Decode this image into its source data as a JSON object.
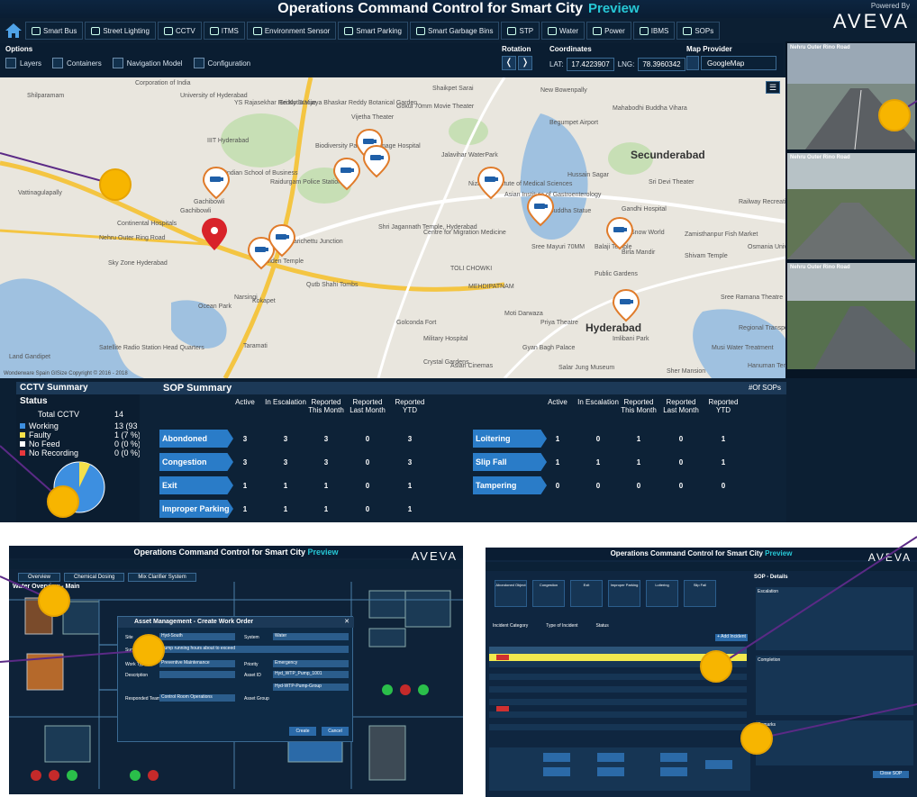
{
  "app": {
    "title": "Operations Command Control for Smart City",
    "preview": "Preview",
    "powered_by": "Powered By",
    "brand": "AVEVA"
  },
  "nav": {
    "items": [
      {
        "label": "Smart Bus",
        "icon": "bus-icon"
      },
      {
        "label": "Street Lighting",
        "icon": "street-light-icon"
      },
      {
        "label": "CCTV",
        "icon": "cctv-icon"
      },
      {
        "label": "ITMS",
        "icon": "traffic-icon"
      },
      {
        "label": "Environment Sensor",
        "icon": "environment-icon"
      },
      {
        "label": "Smart Parking",
        "icon": "parking-icon"
      },
      {
        "label": "Smart Garbage Bins",
        "icon": "garbage-bin-icon"
      },
      {
        "label": "STP",
        "icon": "stp-icon"
      },
      {
        "label": "Water",
        "icon": "water-icon"
      },
      {
        "label": "Power",
        "icon": "power-icon"
      },
      {
        "label": "IBMS",
        "icon": "building-icon"
      },
      {
        "label": "SOPs",
        "icon": "sop-icon"
      }
    ]
  },
  "toolbar": {
    "options_label": "Options",
    "options": [
      "Layers",
      "Containers",
      "Navigation Model",
      "Configuration"
    ],
    "rotation_label": "Rotation",
    "coordinates_label": "Coordinates",
    "lat_label": "LAT:",
    "lat_value": "17.4223907",
    "lng_label": "LNG:",
    "lng_value": "78.3960342",
    "map_provider_label": "Map Provider",
    "map_provider_value": "GoogleMap"
  },
  "map": {
    "copyright": "Wonderware Spain GISize Copyright © 2016 - 2018",
    "labels": [
      "Corporation of India",
      "Shilparamam",
      "Shaikpet Sarai",
      "New Bowenpally",
      "University of Hyderabad",
      "Sri Kotla Vijaya Bhaskar Reddy Botanical Garden",
      "YS Rajasekhar Reddy Statue",
      "Gokul 70mm Movie Theater",
      "Vijetha Theater",
      "Mahabodhi Buddha Vihara",
      "IIIT Hyderabad",
      "Biodiversity Park",
      "Image Hospital",
      "Begumpet Airport",
      "Secunderabad",
      "Indian School of Business",
      "Raidurgam Police Station",
      "Jalavihar WaterPark",
      "Nizam's Institute of Medical Sciences",
      "Sri Devi Theater",
      "Continental Hospitals",
      "Marichettu Junction",
      "Asian Institute of Gastroenterology",
      "Buddha Statue",
      "Gandhi Hospital",
      "Nehru Outer Ring Road",
      "Shri Jagannath Temple, Hyderabad",
      "Sree Mayuri 70MM",
      "Sky Zone Hyderabad",
      "Golden Temple",
      "Centre for Migration Medicine",
      "Birla Mandir",
      "Shivam Temple",
      "Qutb Shahi Tombs",
      "TOLI CHOWKI",
      "Public Gardens",
      "Ocean Park",
      "MEHDIPATNAM",
      "Moti Darwaza",
      "Priya Theatre",
      "Hyderabad",
      "Golconda Fort",
      "Military Hospital",
      "Gyan Bagh Palace",
      "Crystal Gardens",
      "Imlibani Park",
      "Satellite Radio Station Head Quarters",
      "Taramati",
      "Asian Cinemas",
      "Salar Jung Museum",
      "Sher Mansion",
      "Land Gandipet",
      "Gachibowli",
      "Narsingi",
      "Kokapet",
      "Hussain Sagar",
      "Sree Ramana Theatre",
      "Regional Transport Office",
      "Musi Water Treatment",
      "Hanuman Temple",
      "Osmania University",
      "Zamisthanpur Fish Market",
      "Railway Recreation Board Sec",
      "Snow World",
      "Balaji Temple",
      "Gachibowli",
      "Vattinagulapally"
    ]
  },
  "cameras": [
    {
      "label": "Nehru Outer Rino Road"
    },
    {
      "label": "Nehru Outer Rino Road"
    },
    {
      "label": "Nehru Outer Rino Road"
    }
  ],
  "cctv_summary": {
    "title": "CCTV Summary",
    "status_label": "Status",
    "total_label": "Total CCTV",
    "total_value": "14",
    "rows": [
      {
        "label": "Working",
        "value": "13 (93 %)",
        "color": "#3d8fe0"
      },
      {
        "label": "Faulty",
        "value": "1 (7 %)",
        "color": "#f5e04a"
      },
      {
        "label": "No Feed",
        "value": "0 (0 %)",
        "color": "#ffffff"
      },
      {
        "label": "No Recording",
        "value": "0 (0 %)",
        "color": "#e8383d"
      }
    ],
    "pie": {
      "working": 13,
      "faulty": 1
    }
  },
  "sop_summary": {
    "title": "SOP Summary",
    "count_label": "#Of SOPs",
    "columns": [
      "Active",
      "In Escalation",
      "Reported This Month",
      "Reported Last Month",
      "Reported YTD"
    ],
    "left_rows": [
      {
        "label": "Abondoned Object",
        "values": [
          "3",
          "3",
          "3",
          "0",
          "3"
        ]
      },
      {
        "label": "Congestion",
        "values": [
          "3",
          "3",
          "3",
          "0",
          "3"
        ]
      },
      {
        "label": "Exit",
        "values": [
          "1",
          "1",
          "1",
          "0",
          "1"
        ]
      },
      {
        "label": "Improper Parking",
        "values": [
          "1",
          "1",
          "1",
          "0",
          "1"
        ]
      }
    ],
    "right_rows": [
      {
        "label": "Loitering",
        "values": [
          "1",
          "0",
          "1",
          "0",
          "1"
        ]
      },
      {
        "label": "Slip Fall",
        "values": [
          "1",
          "1",
          "1",
          "0",
          "1"
        ]
      },
      {
        "label": "Tampering",
        "values": [
          "0",
          "0",
          "0",
          "0",
          "0"
        ]
      }
    ]
  },
  "water_screen": {
    "title": "Operations Command Control for Smart City",
    "preview": "Preview",
    "brand": "AVEVA",
    "tabs": [
      "Overview",
      "Chemical Dosing",
      "Mix Clarifier System"
    ],
    "section": "Water Overview - Main",
    "labels": [
      "Mix Clarifier System",
      "Air Blowers",
      "Chemical House",
      "Filter Bed Sump",
      "Chemical Dosing Process",
      "Lime Dosing",
      "Alum Dosing Tanks"
    ],
    "dialog": {
      "header": "Asset Management - Create Work Order",
      "fields": [
        "Site",
        "Summary",
        "Work Type",
        "Description",
        "Responded Team",
        "Priority",
        "Asset ID",
        "Asset Group",
        "System"
      ],
      "values": {
        "site": "Hyd-South",
        "system": "Water",
        "summary": "Pump running hours about to exceed",
        "work_type": "Preventive Maintenance",
        "priority": "Emergency",
        "asset_id": "Hyd_WTP_Pump_1001",
        "asset_group": "Hyd-WTP-Pump-Group",
        "team": "Control Room Operations"
      },
      "create": "Create",
      "cancel": "Cancel"
    }
  },
  "sop_screen": {
    "title": "Operations Command Control for Smart City",
    "preview": "Preview",
    "brand": "AVEVA",
    "tiles": [
      "Abondoned Object",
      "Congestion",
      "Exit",
      "Improper Parking",
      "Loitering",
      "Slip Fall"
    ],
    "filters": [
      "Incident Category",
      "Type of Incident",
      "Status"
    ],
    "add_button": "+ Add Incident",
    "detail_title": "SOP - Details",
    "sections": [
      "Escalation",
      "Completion",
      "Remarks"
    ],
    "save": "Save",
    "flow_labels": [
      "Created",
      "Notified",
      "Acknowledged",
      "Completed",
      "Fire Station",
      "Police",
      "Traffic"
    ],
    "close_button": "Close SOP"
  }
}
